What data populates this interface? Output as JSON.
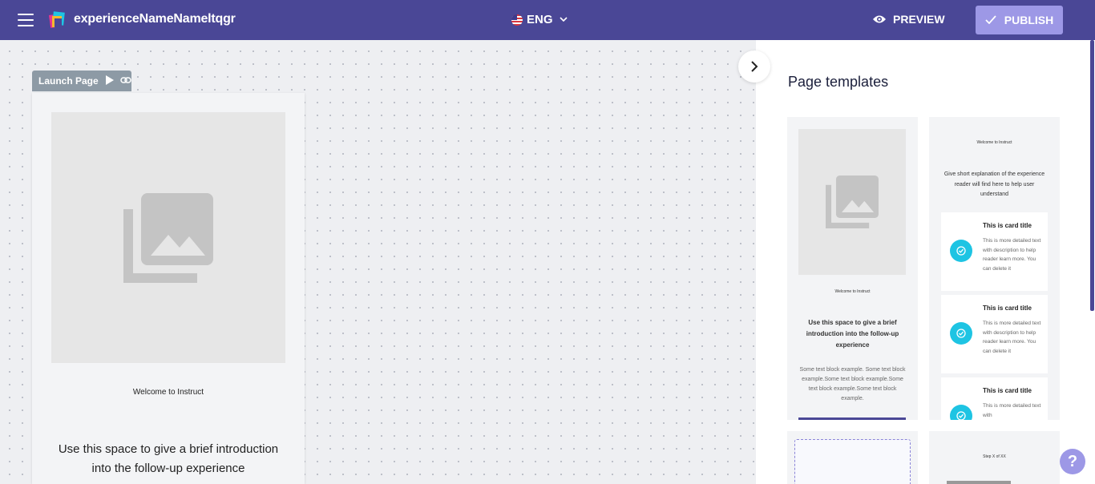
{
  "header": {
    "app_title": "experienceNameNameltqgr",
    "language": "ENG",
    "preview_label": "PREVIEW",
    "publish_label": "PUBLISH",
    "bar_color": "#4a4796",
    "publish_color": "#9d98e6"
  },
  "canvas": {
    "page_tab_label": "Launch Page",
    "page": {
      "welcome": "Welcome to Instruct",
      "intro": "Use this space to give a brief introduction into the follow-up experience"
    }
  },
  "panel": {
    "title": "Page templates",
    "templates": [
      {
        "welcome": "Welcome to Instruct",
        "intro": "Use this space to give a brief introduction into the follow-up experience",
        "text": "Some text block example. Some text block example.Some text block example.Some text block example.Some text block example."
      },
      {
        "welcome": "Welcome to Instruct",
        "heading": "Give short explanation of the experience reader will find here to help user understand",
        "cards": [
          {
            "title": "This is card title",
            "text": "This is more detailed text with description to help reader learn more. You can delete it"
          },
          {
            "title": "This is card title",
            "text": "This is more detailed text with description to help reader learn more. You can delete it"
          },
          {
            "title": "This is card title",
            "text": "This is more detailed text with"
          }
        ]
      },
      {
        "type": "blank"
      },
      {
        "step": "Step X of XX"
      }
    ]
  },
  "help_label": "?",
  "accent_cyan": "#1ec4e3"
}
